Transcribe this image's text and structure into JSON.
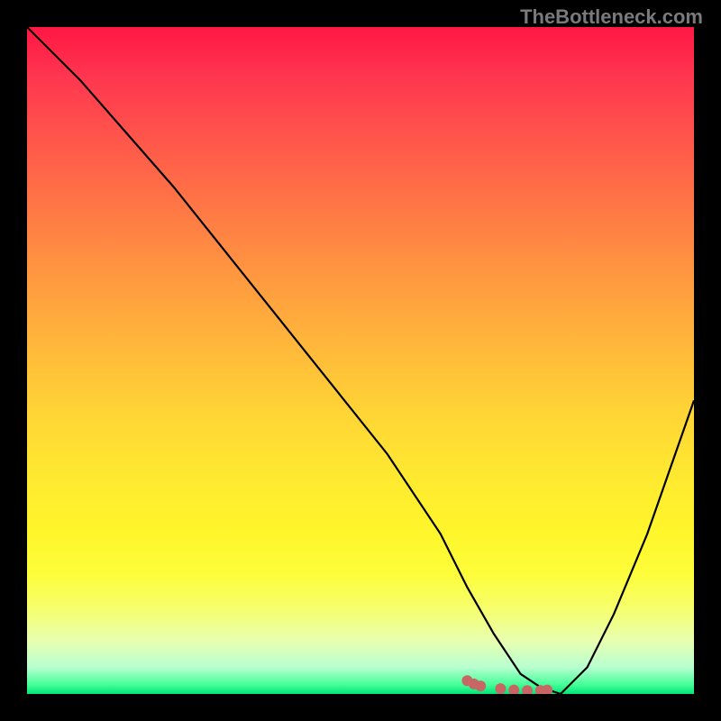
{
  "watermark": "TheBottleneck.com",
  "chart_data": {
    "type": "line",
    "title": "",
    "xlabel": "",
    "ylabel": "",
    "xlim": [
      0,
      100
    ],
    "ylim": [
      0,
      100
    ],
    "series": [
      {
        "name": "bottleneck-curve",
        "x": [
          0,
          8,
          15,
          22,
          30,
          38,
          46,
          54,
          62,
          66,
          70,
          74,
          77,
          80,
          84,
          88,
          93,
          100
        ],
        "values": [
          100,
          92,
          84,
          76,
          66,
          56,
          46,
          36,
          24,
          16,
          9,
          3,
          1,
          0,
          4,
          12,
          24,
          44
        ]
      }
    ],
    "marker_cluster": {
      "name": "highlight-dots",
      "x": [
        66,
        67,
        68,
        71,
        73,
        75,
        77,
        78
      ],
      "values": [
        2,
        1.5,
        1.2,
        0.8,
        0.6,
        0.5,
        0.5,
        0.6
      ]
    },
    "gradient_stops": [
      {
        "pct": 0,
        "color": "#ff1744"
      },
      {
        "pct": 50,
        "color": "#ffc107"
      },
      {
        "pct": 85,
        "color": "#fff176"
      },
      {
        "pct": 100,
        "color": "#00e676"
      }
    ]
  }
}
